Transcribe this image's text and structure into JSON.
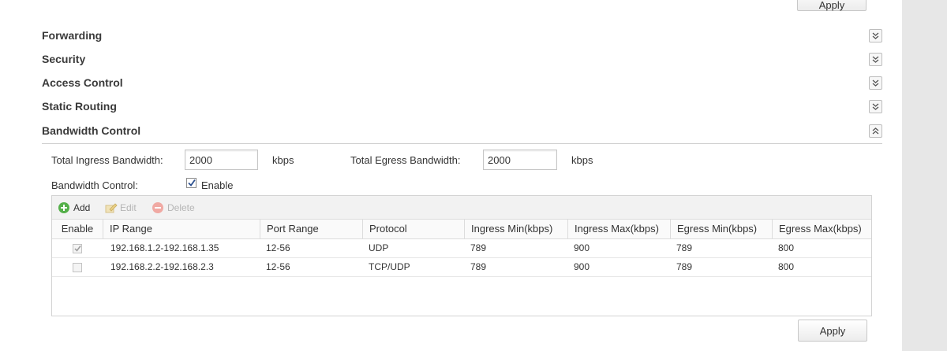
{
  "top_apply_label": "Apply",
  "bottom_apply_label": "Apply",
  "sections": {
    "forwarding": "Forwarding",
    "security": "Security",
    "access_control": "Access Control",
    "static_routing": "Static Routing",
    "bandwidth_control": "Bandwidth Control"
  },
  "bandwidth": {
    "ingress_label": "Total Ingress Bandwidth:",
    "ingress_value": "2000",
    "ingress_unit": "kbps",
    "egress_label": "Total Egress Bandwidth:",
    "egress_value": "2000",
    "egress_unit": "kbps",
    "control_label": "Bandwidth Control:",
    "enable_label": "Enable",
    "enable_checked": true
  },
  "toolbar": {
    "add": "Add",
    "edit": "Edit",
    "delete": "Delete"
  },
  "columns": [
    "Enable",
    "IP Range",
    "Port Range",
    "Protocol",
    "Ingress Min(kbps)",
    "Ingress Max(kbps)",
    "Egress Min(kbps)",
    "Egress Max(kbps)"
  ],
  "rows": [
    {
      "enabled": true,
      "ip_range": "192.168.1.2-192.168.1.35",
      "port_range": "12-56",
      "protocol": "UDP",
      "ingress_min": "789",
      "ingress_max": "900",
      "egress_min": "789",
      "egress_max": "800"
    },
    {
      "enabled": false,
      "ip_range": "192.168.2.2-192.168.2.3",
      "port_range": "12-56",
      "protocol": "TCP/UDP",
      "ingress_min": "789",
      "ingress_max": "900",
      "egress_min": "789",
      "egress_max": "800"
    }
  ],
  "colors": {
    "add_icon": "#55b04a",
    "delete_icon": "#f0a9a3"
  }
}
